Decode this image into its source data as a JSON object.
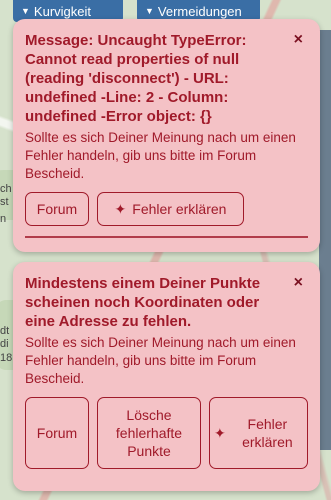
{
  "toolbar": {
    "curvature_label": "Kurvigkeit",
    "avoidances_label": "Vermeidungen"
  },
  "map": {
    "labels": [
      "ch",
      "st",
      "n",
      "dt",
      "di",
      "18",
      "n"
    ]
  },
  "alerts": [
    {
      "title": "Message: Uncaught TypeError: Cannot read properties of null (reading 'disconnect') - URL: undefined -Line: 2 - Column: undefined -Error object: {}",
      "body": "Sollte es sich Deiner Meinung nach um einen Fehler handeln, gib uns bitte im Forum Bescheid.",
      "close": "×",
      "buttons": {
        "forum": "Forum",
        "explain": "Fehler erklären"
      }
    },
    {
      "title": "Mindestens einem Deiner Punkte scheinen noch Koordinaten oder eine Adresse zu fehlen.",
      "body": "Sollte es sich Deiner Meinung nach um einen Fehler handeln, gib uns bitte im Forum Bescheid.",
      "close": "×",
      "buttons": {
        "forum": "Forum",
        "delete_faulty": "Lösche fehlerhafte Punkte",
        "explain": "Fehler erklären"
      }
    }
  ],
  "colors": {
    "alert_bg": "#f4c2c6",
    "alert_text": "#a01a2a",
    "toolbar_bg": "#3a6ea5"
  }
}
